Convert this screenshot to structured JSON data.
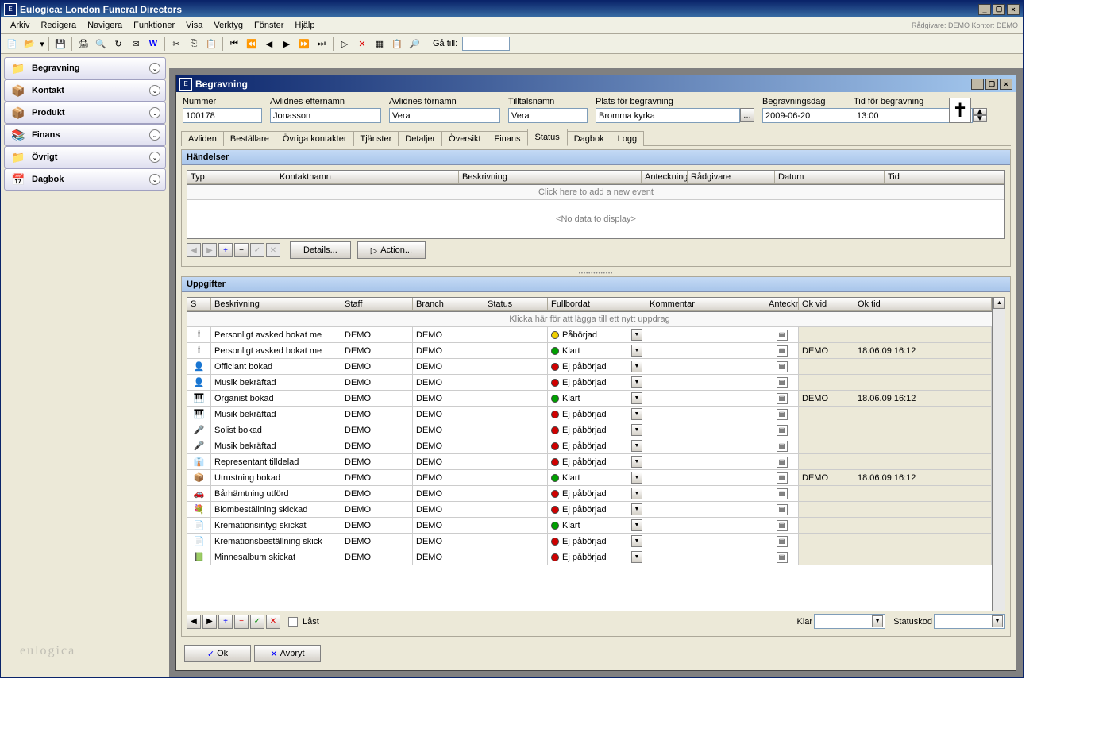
{
  "app_title": "Eulogica: London Funeral Directors",
  "menubar": [
    "Arkiv",
    "Redigera",
    "Navigera",
    "Funktioner",
    "Visa",
    "Verktyg",
    "Fönster",
    "Hjälp"
  ],
  "menubar_info": "Rådgivare: DEMO   Kontor: DEMO",
  "toolbar_goto_label": "Gå till:",
  "sidebar": [
    {
      "label": "Begravning",
      "icon": "📁"
    },
    {
      "label": "Kontakt",
      "icon": "📦"
    },
    {
      "label": "Produkt",
      "icon": "📦"
    },
    {
      "label": "Finans",
      "icon": "📚"
    },
    {
      "label": "Övrigt",
      "icon": "📁"
    },
    {
      "label": "Dagbok",
      "icon": "📅"
    }
  ],
  "sidebar_brand": "eulogica",
  "subwin": {
    "title": "Begravning",
    "form": {
      "nummer_label": "Nummer",
      "nummer": "100178",
      "efternamn_label": "Avlidnes efternamn",
      "efternamn": "Jonasson",
      "fornamn_label": "Avlidnes förnamn",
      "fornamn": "Vera",
      "tilltal_label": "Tilltalsnamn",
      "tilltal": "Vera",
      "plats_label": "Plats för begravning",
      "plats": "Bromma kyrka",
      "dag_label": "Begravningsdag",
      "dag": "2009-06-20",
      "tid_label": "Tid för begravning",
      "tid": "13:00"
    },
    "tabs": [
      "Avliden",
      "Beställare",
      "Övriga kontakter",
      "Tjänster",
      "Detaljer",
      "Översikt",
      "Finans",
      "Status",
      "Dagbok",
      "Logg"
    ],
    "active_tab": "Status",
    "handelser": {
      "title": "Händelser",
      "cols": [
        "Typ",
        "Kontaktnamn",
        "Beskrivning",
        "Anteckning",
        "Rådgivare",
        "Datum",
        "Tid"
      ],
      "add_text": "Click here to add a new event",
      "empty": "<No data to display>",
      "details_btn": "Details...",
      "action_btn": "Action..."
    },
    "uppgifter": {
      "title": "Uppgifter",
      "cols": [
        "S",
        "Beskrivning",
        "Staff",
        "Branch",
        "Status",
        "Fullbordat",
        "Kommentar",
        "Anteckning",
        "Ok vid",
        "Ok tid"
      ],
      "add_text": "Klicka här för att lägga till ett nytt uppdrag",
      "rows": [
        {
          "icon": "🕯",
          "desc": "Personligt avsked bokat me",
          "staff": "DEMO",
          "branch": "DEMO",
          "full": "Påbörjad",
          "dot": "#f0d000",
          "okvid": "",
          "oktid": ""
        },
        {
          "icon": "🕯",
          "desc": "Personligt avsked bokat me",
          "staff": "DEMO",
          "branch": "DEMO",
          "full": "Klart",
          "dot": "#00a000",
          "okvid": "DEMO",
          "oktid": "18.06.09 16:12"
        },
        {
          "icon": "👤",
          "desc": "Officiant bokad",
          "staff": "DEMO",
          "branch": "DEMO",
          "full": "Ej påbörjad",
          "dot": "#d00000",
          "okvid": "",
          "oktid": ""
        },
        {
          "icon": "👤",
          "desc": "Musik bekräftad",
          "staff": "DEMO",
          "branch": "DEMO",
          "full": "Ej påbörjad",
          "dot": "#d00000",
          "okvid": "",
          "oktid": ""
        },
        {
          "icon": "🎹",
          "desc": "Organist bokad",
          "staff": "DEMO",
          "branch": "DEMO",
          "full": "Klart",
          "dot": "#00a000",
          "okvid": "DEMO",
          "oktid": "18.06.09 16:12"
        },
        {
          "icon": "🎹",
          "desc": "Musik bekräftad",
          "staff": "DEMO",
          "branch": "DEMO",
          "full": "Ej påbörjad",
          "dot": "#d00000",
          "okvid": "",
          "oktid": ""
        },
        {
          "icon": "🎤",
          "desc": "Solist bokad",
          "staff": "DEMO",
          "branch": "DEMO",
          "full": "Ej påbörjad",
          "dot": "#d00000",
          "okvid": "",
          "oktid": ""
        },
        {
          "icon": "🎤",
          "desc": "Musik bekräftad",
          "staff": "DEMO",
          "branch": "DEMO",
          "full": "Ej påbörjad",
          "dot": "#d00000",
          "okvid": "",
          "oktid": ""
        },
        {
          "icon": "👔",
          "desc": "Representant tilldelad",
          "staff": "DEMO",
          "branch": "DEMO",
          "full": "Ej påbörjad",
          "dot": "#d00000",
          "okvid": "",
          "oktid": ""
        },
        {
          "icon": "📦",
          "desc": "Utrustning bokad",
          "staff": "DEMO",
          "branch": "DEMO",
          "full": "Klart",
          "dot": "#00a000",
          "okvid": "DEMO",
          "oktid": "18.06.09 16:12"
        },
        {
          "icon": "🚗",
          "desc": "Bårhämtning utförd",
          "staff": "DEMO",
          "branch": "DEMO",
          "full": "Ej påbörjad",
          "dot": "#d00000",
          "okvid": "",
          "oktid": ""
        },
        {
          "icon": "💐",
          "desc": "Blombeställning skickad",
          "staff": "DEMO",
          "branch": "DEMO",
          "full": "Ej påbörjad",
          "dot": "#d00000",
          "okvid": "",
          "oktid": ""
        },
        {
          "icon": "📄",
          "desc": "Kremationsintyg skickat",
          "staff": "DEMO",
          "branch": "DEMO",
          "full": "Klart",
          "dot": "#00a000",
          "okvid": "",
          "oktid": ""
        },
        {
          "icon": "📄",
          "desc": "Kremationsbeställning skick",
          "staff": "DEMO",
          "branch": "DEMO",
          "full": "Ej påbörjad",
          "dot": "#d00000",
          "okvid": "",
          "oktid": ""
        },
        {
          "icon": "📗",
          "desc": "Minnesalbum skickat",
          "staff": "DEMO",
          "branch": "DEMO",
          "full": "Ej påbörjad",
          "dot": "#d00000",
          "okvid": "",
          "oktid": ""
        }
      ],
      "locked_label": "Låst",
      "klar_label": "Klar",
      "statuskod_label": "Statuskod"
    },
    "ok_btn": "Ok",
    "cancel_btn": "Avbryt"
  }
}
